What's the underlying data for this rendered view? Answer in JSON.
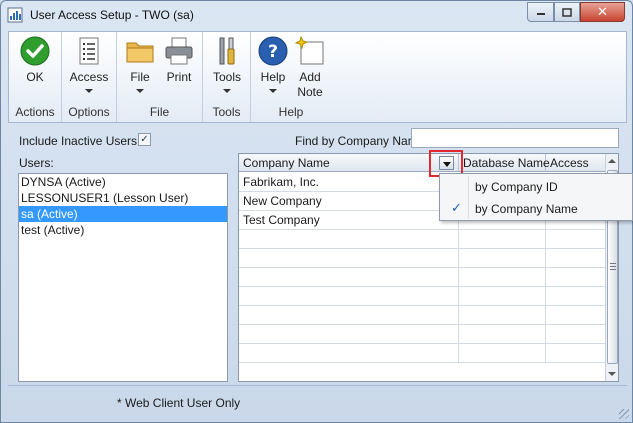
{
  "window": {
    "title": "User Access Setup  -  TWO (sa)",
    "close_glyph": "✕",
    "icons": [
      "app-icon",
      "minimize-icon",
      "maximize-icon",
      "close-icon"
    ]
  },
  "ribbon": {
    "groups": [
      {
        "label": "Actions",
        "buttons": [
          {
            "label": "OK",
            "icon": "checkmark-icon"
          }
        ]
      },
      {
        "label": "Options",
        "buttons": [
          {
            "label": "Access",
            "icon": "list-icon",
            "dropdown": true
          }
        ]
      },
      {
        "label": "File",
        "buttons": [
          {
            "label": "File",
            "icon": "folder-icon",
            "dropdown": true
          },
          {
            "label": "Print",
            "icon": "printer-icon"
          }
        ]
      },
      {
        "label": "Tools",
        "buttons": [
          {
            "label": "Tools",
            "icon": "tools-icon",
            "dropdown": true
          }
        ]
      },
      {
        "label": "Help",
        "buttons": [
          {
            "label": "Help",
            "icon": "help-icon",
            "dropdown": true
          },
          {
            "label": "Add\nNote",
            "icon": "note-icon"
          }
        ]
      }
    ]
  },
  "filters": {
    "include_inactive_label": "Include Inactive Users",
    "include_inactive_checked": true,
    "checkmark": "✓",
    "find_label": "Find by Company Name",
    "find_value": ""
  },
  "users": {
    "label": "Users:",
    "items": [
      "DYNSA (Active)",
      "LESSONUSER1 (Lesson User)",
      "sa (Active)",
      "test (Active)"
    ],
    "selected_index": 2
  },
  "grid": {
    "columns": [
      "Company Name",
      "Database Name",
      "Access"
    ],
    "rows": [
      {
        "company": "Fabrikam, Inc.",
        "database": "",
        "access": ""
      },
      {
        "company": "New Company",
        "database": "",
        "access": ""
      },
      {
        "company": "Test Company",
        "database": "",
        "access": ""
      }
    ],
    "empty_rows": 7
  },
  "sort_menu": {
    "items": [
      {
        "label": "by Company ID",
        "checked": false
      },
      {
        "label": "by Company Name",
        "checked": true
      }
    ],
    "check_glyph": "✓"
  },
  "footer": {
    "note": "* Web Client User Only"
  },
  "colors": {
    "selection": "#3399ff",
    "highlight_box": "#e0282d",
    "ok_icon": "#2f9e2f",
    "help_icon": "#2a5fb0"
  }
}
